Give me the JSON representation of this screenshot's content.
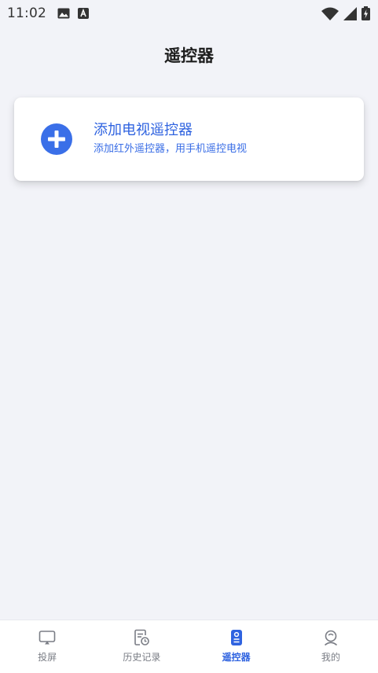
{
  "status_bar": {
    "time": "11:02",
    "icons": [
      "image-icon",
      "a-badge-icon",
      "wifi-icon",
      "signal-icon",
      "battery-icon"
    ]
  },
  "header": {
    "title": "遥控器"
  },
  "add_card": {
    "icon": "plus-circle-icon",
    "title": "添加电视遥控器",
    "subtitle": "添加红外遥控器，用手机遥控电视"
  },
  "tabs": [
    {
      "label": "投屏",
      "icon": "cast-screen-icon",
      "active": false
    },
    {
      "label": "历史记录",
      "icon": "history-icon",
      "active": false
    },
    {
      "label": "遥控器",
      "icon": "remote-icon",
      "active": true
    },
    {
      "label": "我的",
      "icon": "profile-icon",
      "active": false
    }
  ],
  "colors": {
    "accent": "#2f63e0",
    "background": "#f2f3f8",
    "inactive_tab": "#7a7d85"
  }
}
